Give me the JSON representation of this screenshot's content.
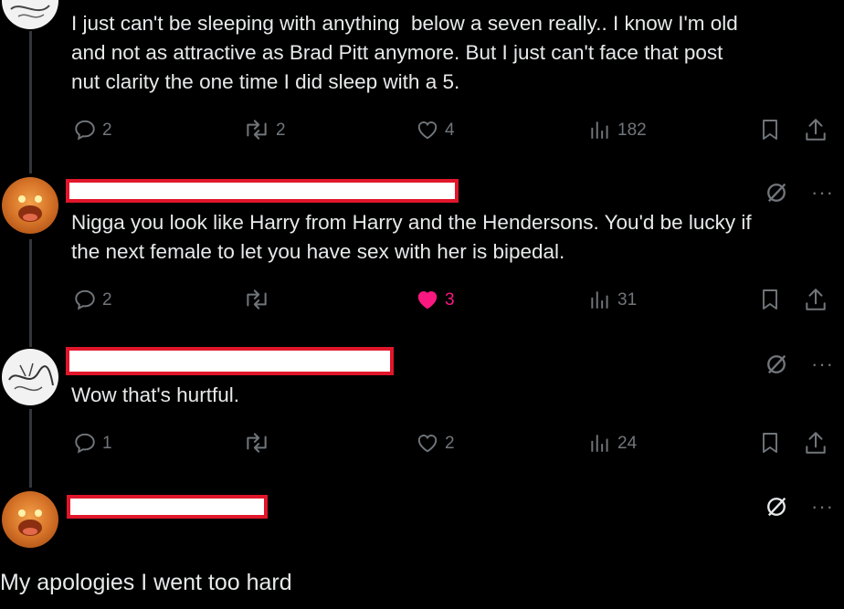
{
  "tweets": [
    {
      "text": "I just can't be sleeping with anything  below a seven really.. I know I'm old\nand not as attractive as Brad Pitt anymore. But I just can't face that post\nnut clarity the one time I did sleep with a 5.",
      "replies": "2",
      "reposts": "2",
      "likes": "4",
      "views": "182",
      "liked": false
    },
    {
      "text": "Nigga you look like Harry from Harry and the Hendersons. You'd be lucky if\nthe next female to let you have sex with her is bipedal.",
      "replies": "2",
      "reposts": "",
      "likes": "3",
      "views": "31",
      "liked": true
    },
    {
      "text": "Wow that's hurtful.",
      "replies": "1",
      "reposts": "",
      "likes": "2",
      "views": "24",
      "liked": false
    }
  ],
  "more_label": "···",
  "bottom_text": "My apologies I went too hard",
  "colors": {
    "background": "#000000",
    "text": "#e7e9ea",
    "muted": "#71767b",
    "like": "#f91880",
    "redaction_border": "#e0162b"
  },
  "icons": [
    "reply-icon",
    "repost-icon",
    "like-icon",
    "views-icon",
    "bookmark-icon",
    "share-icon",
    "grok-icon",
    "more-icon"
  ]
}
